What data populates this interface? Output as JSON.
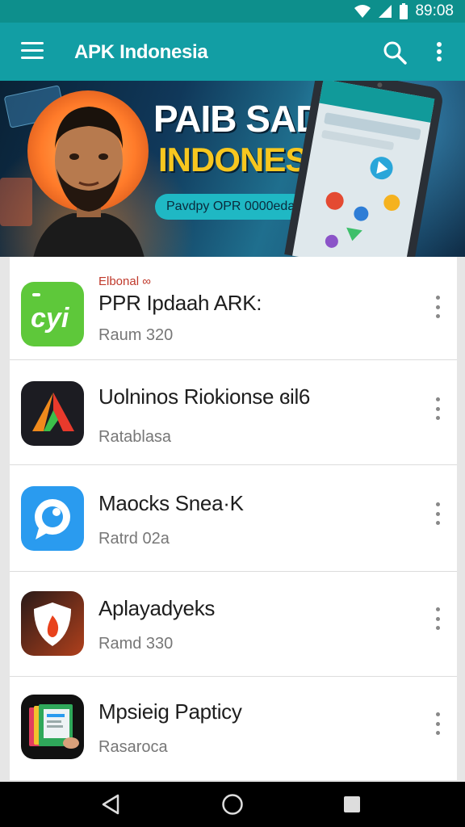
{
  "status_bar": {
    "time": "89:08",
    "icons": [
      "wifi-icon",
      "cell-signal-icon",
      "battery-icon"
    ]
  },
  "app_bar": {
    "title": "APK Indonesia",
    "icons": [
      "menu-icon",
      "search-icon",
      "more-vert-icon"
    ],
    "color": "#129ea4"
  },
  "banner": {
    "headline_1": "PAIB SADA",
    "headline_2": "INDONESIA",
    "pill_text": "Pavdpy OPR 0000eda",
    "colors": {
      "headline_2": "#f7c71f",
      "pill": "#1fb8c4"
    }
  },
  "apps": [
    {
      "category": "Elbonal ∞",
      "name": "PPR Ipdaah ARK:",
      "subtitle": "Raum 320",
      "icon": "green-cyi-app-icon"
    },
    {
      "category": "",
      "name": "Uolninos Riokionse ɞil6",
      "subtitle": "Ratablasa",
      "icon": "red-orange-triangle-app-icon"
    },
    {
      "category": "",
      "name": "Maocks Snea·K",
      "subtitle": "Ratrd 02a",
      "icon": "blue-chat-app-icon"
    },
    {
      "category": "",
      "name": "Aplayadyeks",
      "subtitle": "Ramd 330",
      "icon": "shield-flame-app-icon"
    },
    {
      "category": "",
      "name": "Mpsieig Papticy",
      "subtitle": "Rasaroca",
      "icon": "document-stack-app-icon"
    }
  ],
  "nav_bar": {
    "buttons": [
      "back-icon",
      "home-icon",
      "recents-icon"
    ]
  }
}
